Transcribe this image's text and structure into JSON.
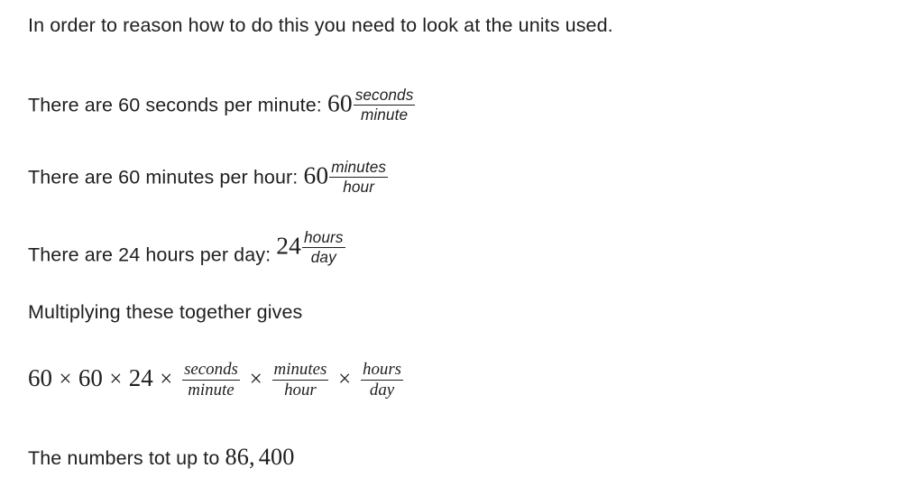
{
  "document": {
    "background_color": "#ffffff",
    "text_color": "#1f1f1f"
  },
  "lines": {
    "intro": "In order to reason how to do this you need to look at the units used.",
    "seconds_per_minute_text": "There are 60 seconds per minute:",
    "minutes_per_hour_text": "There are 60 minutes per hour:",
    "hours_per_day_text": "There are 24 hours per day:",
    "multiply_text": "Multiplying these together gives",
    "result_text": "The numbers tot up to",
    "result_value": "86,",
    "result_value_rest": "400"
  },
  "math": {
    "seconds_per_minute": {
      "coefficient": "60",
      "numerator": "seconds",
      "denominator": "minute"
    },
    "minutes_per_hour": {
      "coefficient": "60",
      "numerator": "minutes",
      "denominator": "hour"
    },
    "hours_per_day": {
      "coefficient": "24",
      "numerator": "hours",
      "denominator": "day"
    },
    "equation": {
      "factor1": "60",
      "factor2": "60",
      "factor3": "24",
      "times": "×",
      "frac1": {
        "numerator": "seconds",
        "denominator": "minute"
      },
      "frac2": {
        "numerator": "minutes",
        "denominator": "hour"
      },
      "frac3": {
        "numerator": "hours",
        "denominator": "day"
      }
    }
  }
}
